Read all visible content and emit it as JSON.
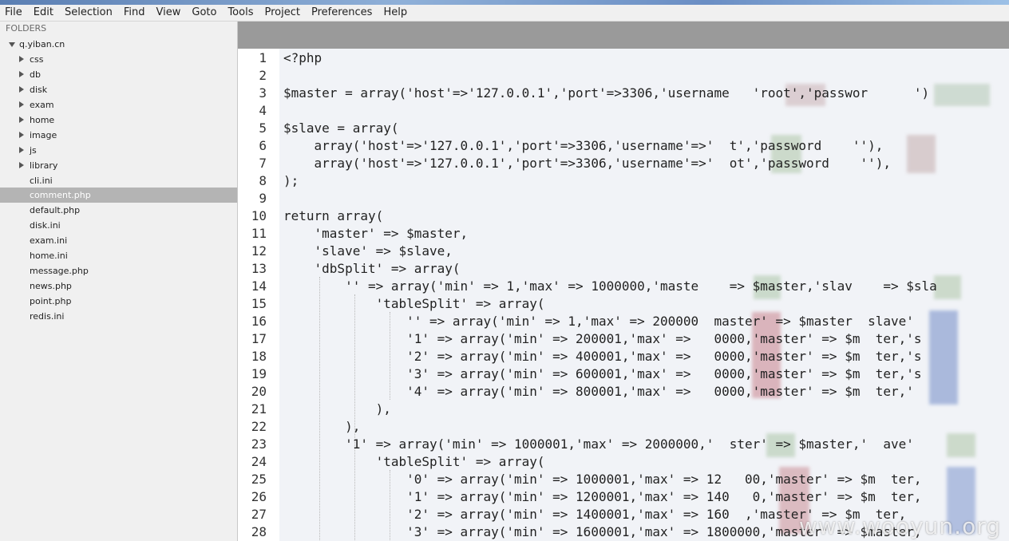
{
  "menu": {
    "items": [
      "File",
      "Edit",
      "Selection",
      "Find",
      "View",
      "Goto",
      "Tools",
      "Project",
      "Preferences",
      "Help"
    ]
  },
  "sidebar": {
    "header": "FOLDERS",
    "root": "q.yiban.cn",
    "folders": [
      "css",
      "db",
      "disk",
      "exam",
      "home",
      "image",
      "js",
      "library"
    ],
    "files": [
      "cli.ini",
      "comment.php",
      "default.php",
      "disk.ini",
      "exam.ini",
      "home.ini",
      "message.php",
      "news.php",
      "point.php",
      "redis.ini"
    ],
    "selected_file": "comment.php"
  },
  "editor": {
    "line_numbers": [
      "1",
      "2",
      "3",
      "4",
      "5",
      "6",
      "7",
      "8",
      "9",
      "10",
      "11",
      "12",
      "13",
      "14",
      "15",
      "16",
      "17",
      "18",
      "19",
      "20",
      "21",
      "22",
      "23",
      "24",
      "25",
      "26",
      "27",
      "28"
    ],
    "lines": [
      "<?php",
      "",
      "$master = array('host'=>'127.0.0.1','port'=>3306,'username   'root','passwor      ')",
      "",
      "$slave = array(",
      "    array('host'=>'127.0.0.1','port'=>3306,'username'=>'  t','password    ''),",
      "    array('host'=>'127.0.0.1','port'=>3306,'username'=>'  ot','password    ''),",
      ");",
      "",
      "return array(",
      "    'master' => $master,",
      "    'slave' => $slave,",
      "    'dbSplit' => array(",
      "        '' => array('min' => 1,'max' => 1000000,'maste    => $master,'slav    => $sla",
      "            'tableSplit' => array(",
      "                '' => array('min' => 1,'max' => 200000  master' => $master  slave'",
      "                '1' => array('min' => 200001,'max' =>   0000,'master' => $m  ter,'s",
      "                '2' => array('min' => 400001,'max' =>   0000,'master' => $m  ter,'s",
      "                '3' => array('min' => 600001,'max' =>   0000,'master' => $m  ter,'s",
      "                '4' => array('min' => 800001,'max' =>   0000,'master' => $m  ter,'",
      "            ),",
      "        ),",
      "        '1' => array('min' => 1000001,'max' => 2000000,'  ster' => $master,'  ave'",
      "            'tableSplit' => array(",
      "                '0' => array('min' => 1000001,'max' => 12   00,'master' => $m  ter,",
      "                '1' => array('min' => 1200001,'max' => 140   0,'master' => $m  ter,",
      "                '2' => array('min' => 1400001,'max' => 160  ,'master' => $m  ter,",
      "                '3' => array('min' => 1600001,'max' => 1800000,'master' => $master,"
    ]
  },
  "watermark": "www.wooyun.org"
}
